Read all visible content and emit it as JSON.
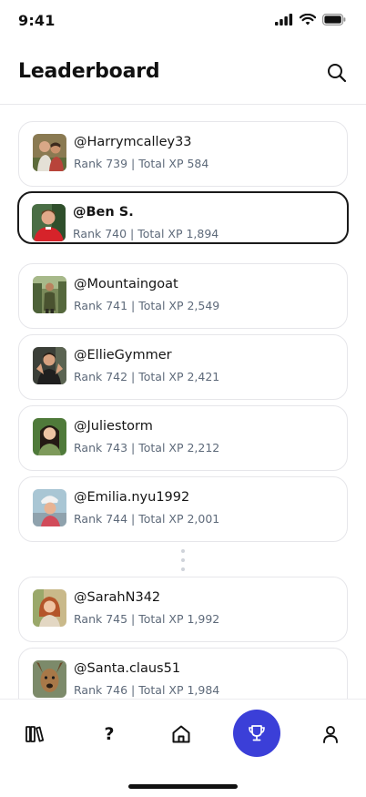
{
  "status_bar": {
    "time": "9:41"
  },
  "header": {
    "title": "Leaderboard"
  },
  "leaderboard": {
    "entries": [
      {
        "username": "@Harrymcalley33",
        "meta": "Rank 739 | Total XP 584",
        "selected": false
      },
      {
        "username": "@Ben S.",
        "meta": "Rank 740 | Total XP 1,894",
        "selected": true
      },
      {
        "username": "@Mountaingoat",
        "meta": "Rank 741 | Total XP 2,549",
        "selected": false
      },
      {
        "username": "@EllieGymmer",
        "meta": "Rank 742 | Total XP 2,421",
        "selected": false
      },
      {
        "username": "@Juliestorm",
        "meta": "Rank 743 | Total XP 2,212",
        "selected": false
      },
      {
        "username": "@Emilia.nyu1992",
        "meta": "Rank 744 | Total XP 2,001",
        "selected": false
      },
      {
        "username": "@SarahN342",
        "meta": "Rank 745 | Total XP 1,992",
        "selected": false
      },
      {
        "username": "@Santa.claus51",
        "meta": "Rank 746 | Total XP 1,984",
        "selected": false
      }
    ]
  },
  "bottom_nav": {
    "items": [
      {
        "icon": "library-icon"
      },
      {
        "icon": "help-icon",
        "label": "?"
      },
      {
        "icon": "home-icon"
      },
      {
        "icon": "trophy-icon",
        "active": true
      },
      {
        "icon": "profile-icon"
      }
    ]
  },
  "colors": {
    "accent": "#3b3fd8",
    "meta_text": "#5e6a7a",
    "card_border": "#e6e6ea",
    "selected_border": "#1a1a1a"
  }
}
